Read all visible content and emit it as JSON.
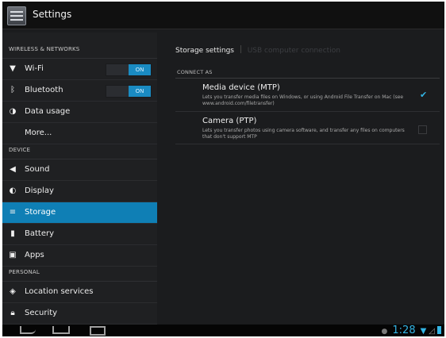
{
  "app": {
    "title": "Settings"
  },
  "sidebar": {
    "sections": [
      {
        "label": "WIRELESS & NETWORKS"
      },
      {
        "label": "DEVICE"
      },
      {
        "label": "PERSONAL"
      }
    ],
    "items": [
      {
        "label": "Wi-Fi",
        "icon": "wifi-icon",
        "toggle": "ON"
      },
      {
        "label": "Bluetooth",
        "icon": "bluetooth-icon",
        "toggle": "ON"
      },
      {
        "label": "Data usage",
        "icon": "data-usage-icon"
      },
      {
        "label": "More..."
      },
      {
        "label": "Sound",
        "icon": "speaker-icon"
      },
      {
        "label": "Display",
        "icon": "display-icon"
      },
      {
        "label": "Storage",
        "icon": "storage-icon",
        "selected": true
      },
      {
        "label": "Battery",
        "icon": "battery-icon"
      },
      {
        "label": "Apps",
        "icon": "apps-icon"
      },
      {
        "label": "Location services",
        "icon": "location-icon"
      },
      {
        "label": "Security",
        "icon": "lock-icon"
      }
    ]
  },
  "main": {
    "tabs": [
      {
        "label": "Storage settings",
        "active": true
      },
      {
        "label": "USB computer connection",
        "active": false
      }
    ],
    "section_label": "CONNECT AS",
    "prefs": [
      {
        "title": "Media device (MTP)",
        "description": "Lets you transfer media files on Windows, or using Android File Transfer on Mac (see www.android.com/filetransfer)",
        "checked": true
      },
      {
        "title": "Camera (PTP)",
        "description": "Lets you transfer photos using camera software, and transfer any files on computers that don't support MTP",
        "checked": false
      }
    ]
  },
  "statusbar": {
    "time": "1:28"
  },
  "colors": {
    "accent": "#33b5e5",
    "selected": "#0f7fb5",
    "background": "#1b1c1e"
  }
}
